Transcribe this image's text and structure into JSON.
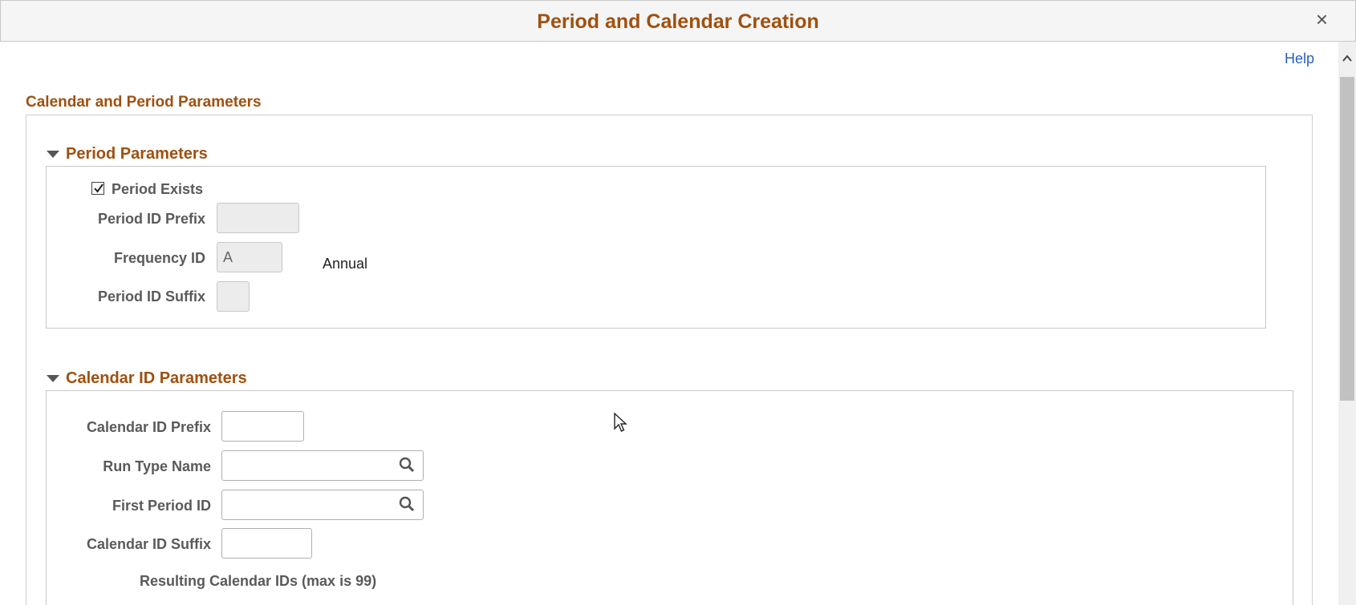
{
  "window": {
    "title": "Period and Calendar Creation",
    "close_glyph": "×"
  },
  "help_link": "Help",
  "main": {
    "section_title": "Calendar and Period Parameters",
    "period_parameters": {
      "heading": "Period Parameters",
      "period_exists_label": "Period Exists",
      "period_exists_checked": true,
      "period_id_prefix_label": "Period ID Prefix",
      "period_id_prefix_value": "",
      "frequency_id_label": "Frequency ID",
      "frequency_id_value": "A",
      "frequency_description": "Annual",
      "period_id_suffix_label": "Period ID Suffix",
      "period_id_suffix_value": ""
    },
    "calendar_id_parameters": {
      "heading": "Calendar ID Parameters",
      "calendar_id_prefix_label": "Calendar ID Prefix",
      "calendar_id_prefix_value": "",
      "run_type_name_label": "Run Type Name",
      "run_type_name_value": "",
      "first_period_id_label": "First Period ID",
      "first_period_id_value": "",
      "calendar_id_suffix_label": "Calendar ID Suffix",
      "calendar_id_suffix_value": "",
      "resulting_label": "Resulting Calendar IDs (max is 99)"
    }
  },
  "icons": {
    "close": "close-icon",
    "collapse": "triangle-down-icon",
    "lookup": "search-icon",
    "scroll_up": "chevron-up-icon",
    "pointer": "mouse-cursor-icon"
  },
  "colors": {
    "heading": "#a0500f",
    "link": "#2a5fbf",
    "label": "#5a5a5a",
    "disabled_field": "#ececec"
  }
}
